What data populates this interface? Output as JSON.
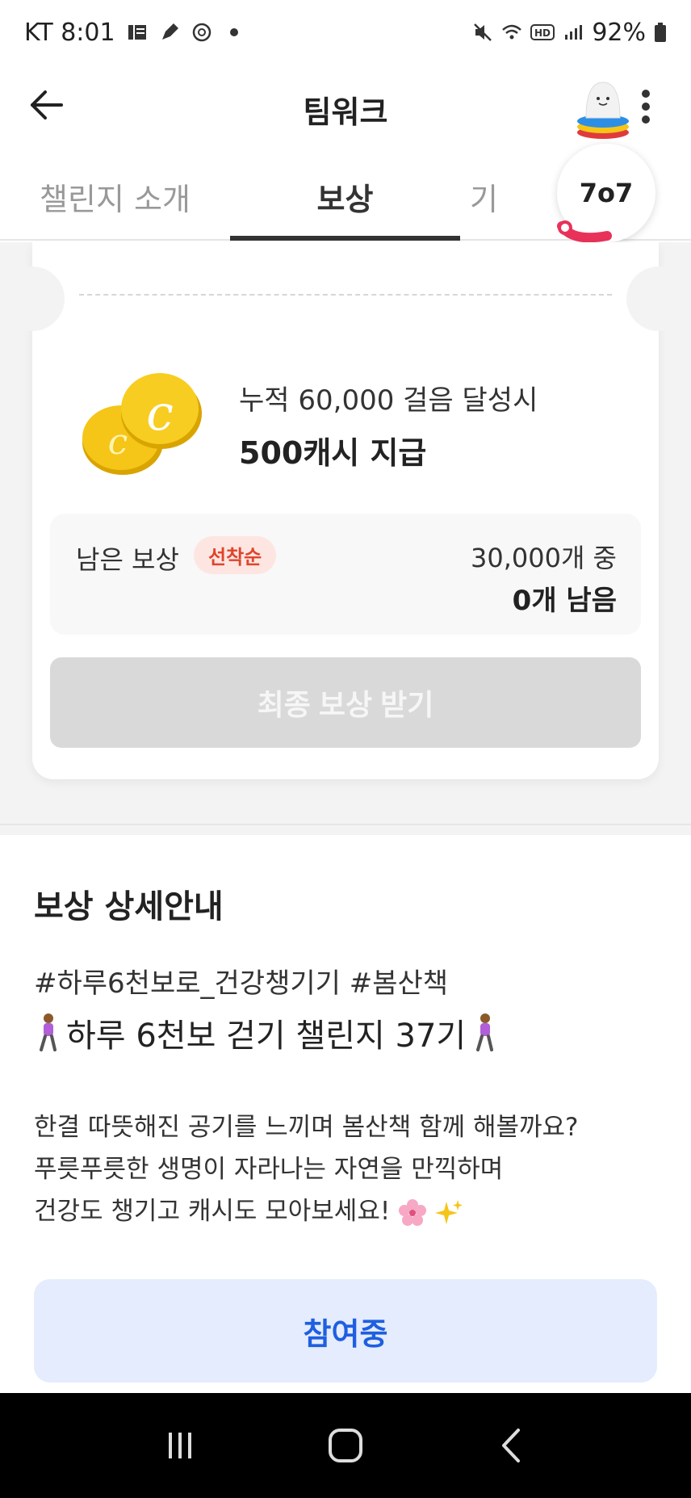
{
  "status_bar": {
    "carrier_time": "KT 8:01",
    "battery": "92%"
  },
  "header": {
    "title": "팀워크"
  },
  "tabs": [
    {
      "label": "챌린지 소개",
      "active": false
    },
    {
      "label": "보상",
      "active": true
    },
    {
      "label": "기",
      "active": false
    }
  ],
  "float_counter": {
    "value": "7o7"
  },
  "reward": {
    "condition": "누적 60,000 걸음 달성시",
    "amount": "500캐시 지급",
    "remaining_label": "남은 보상",
    "badge": "선착순",
    "total": "30,000개 중",
    "remaining": "0개 남음",
    "final_button": "최종 보상 받기"
  },
  "details": {
    "title": "보상 상세안내",
    "tags": "#하루6천보로_건강챙기기 #봄산책",
    "headline": "하루 6천보 걷기 챌린지 37기",
    "body_lines": [
      "한결 따뜻해진 공기를 느끼며 봄산책 함께 해볼까요?",
      "푸릇푸릇한 생명이 자라나는 자연을 만끽하며",
      "건강도 챙기고 캐시도 모아보세요!"
    ],
    "join_button": "참여중"
  },
  "colors": {
    "accent_blue": "#1f5fe0",
    "badge_red": "#e0442b",
    "coin_gold": "#f5c518"
  }
}
